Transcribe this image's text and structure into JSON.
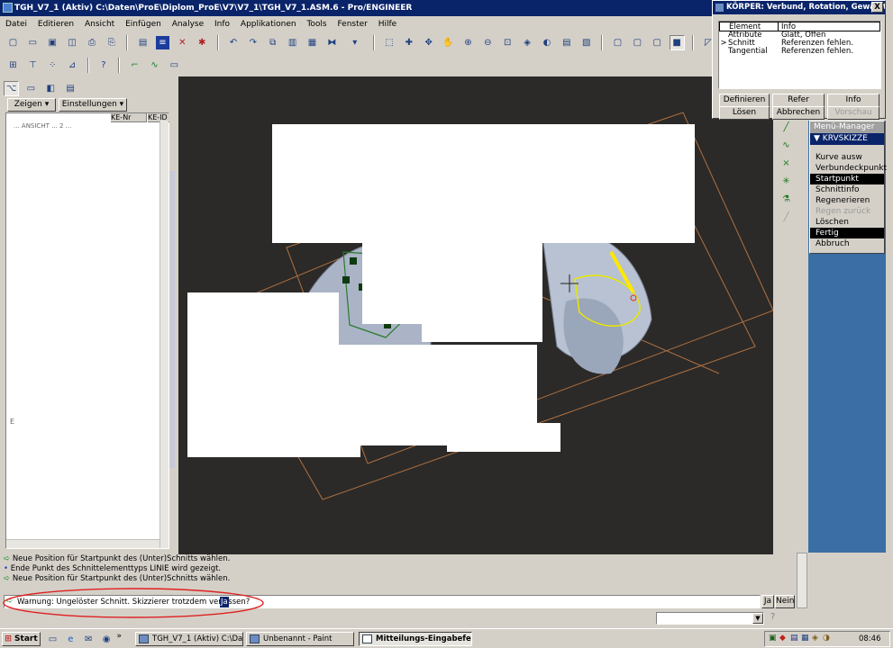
{
  "window": {
    "title": "TGH_V7_1 (Aktiv) C:\\Daten\\ProE\\Diplom_ProE\\V7\\V7_1\\TGH_V7_1.ASM.6 - Pro/ENGINEER"
  },
  "menu": [
    "Datei",
    "Editieren",
    "Ansicht",
    "Einfügen",
    "Analyse",
    "Info",
    "Applikationen",
    "Tools",
    "Fenster",
    "Hilfe"
  ],
  "toolbar_icons": {
    "row1": [
      "new-icon",
      "open-icon",
      "save-icon",
      "save-as-icon",
      "print-icon",
      "print-preview-icon",
      "mapkey-icon",
      "relations-icon",
      "delete-icon",
      "regenerate-icon",
      "undo-icon",
      "redo-icon",
      "copy-icon",
      "paste-icon",
      "paste-special-icon",
      "mirror-icon",
      "select-filter-icon",
      "repaint-icon",
      "spin-center-icon",
      "orient-icon",
      "pan-icon",
      "zoom-in-icon",
      "zoom-out-icon",
      "refit-icon",
      "view-manager-icon",
      "saved-views-icon",
      "layers-icon",
      "wireframe-icon",
      "hidden-line-icon",
      "no-hidden-icon",
      "shading-icon",
      "sketch-icon"
    ],
    "row2": [
      "datum-planes-icon",
      "datum-axes-icon",
      "datum-points-icon",
      "coord-systems-icon",
      "context-help-icon",
      "sketch-tool-icon",
      "datum-curve-icon",
      "analysis-icon"
    ]
  },
  "model_tree": {
    "tab_icons": [
      "model-tree-icon",
      "folder-icon",
      "favorites-icon",
      "layers-icon"
    ],
    "show_label": "Zeigen",
    "settings_label": "Einstellungen",
    "columns": [
      "KE-Nr",
      "KE-ID"
    ],
    "first_row_truncated": "... ANSICHT ... 2 ...",
    "left_marker": "E"
  },
  "dialog": {
    "title": "KÖRPER: Verbund, Rotation, Gewählt...",
    "close": "X",
    "headers": [
      "Element",
      "Info"
    ],
    "rows": [
      {
        "element": "Attribute",
        "info": "Glatt, Offen",
        "marker": ""
      },
      {
        "element": "Schnitt",
        "info": "Referenzen fehlen.",
        "marker": ">"
      },
      {
        "element": "Tangential",
        "info": "Referenzen fehlen.",
        "marker": ""
      }
    ],
    "buttons": {
      "define": "Definieren",
      "refs": "Refer",
      "info": "Info",
      "ok": "Lösen",
      "cancel": "Abbrechen",
      "preview": "Vorschau"
    }
  },
  "menu_manager": {
    "title": "Menü-Manager",
    "section": "KRVSKIZZE",
    "items": [
      {
        "label": "Kurve ausw",
        "state": "normal"
      },
      {
        "label": "Verbundeckpunkt",
        "state": "normal"
      },
      {
        "label": "Startpunkt",
        "state": "selected"
      },
      {
        "label": "Schnittinfo",
        "state": "normal"
      },
      {
        "label": "Regenerieren",
        "state": "normal"
      },
      {
        "label": "Regen zurück",
        "state": "disabled"
      },
      {
        "label": "Löschen",
        "state": "normal"
      },
      {
        "label": "Fertig",
        "state": "selected"
      },
      {
        "label": "Abbruch",
        "state": "normal"
      }
    ]
  },
  "messages": [
    {
      "icon": "arrow",
      "text": "Neue Position für Startpunkt des (Unter)Schnitts wählen."
    },
    {
      "icon": "dot",
      "text": "Ende Punkt des Schnittelementtyps LINIE wird gezeigt."
    },
    {
      "icon": "arrow",
      "text": "Neue Position für Startpunkt des (Unter)Schnitts wählen."
    }
  ],
  "prompt": {
    "text": "Warnung: Ungelöster Schnitt. Skizzierer trotzdem verlassen?",
    "input_value": "Ja",
    "yes": "Ja",
    "no": "Nein"
  },
  "highlight_color": "#e02020",
  "taskbar": {
    "start": "Start",
    "more": "»",
    "tasks": [
      {
        "label": "TGH_V7_1 (Aktiv) C:\\Dat...",
        "active": false
      },
      {
        "label": "Unbenannt - Paint",
        "active": false
      },
      {
        "label": "Mitteilungs-Eingabefe...",
        "active": true
      }
    ],
    "clock": "08:46"
  }
}
